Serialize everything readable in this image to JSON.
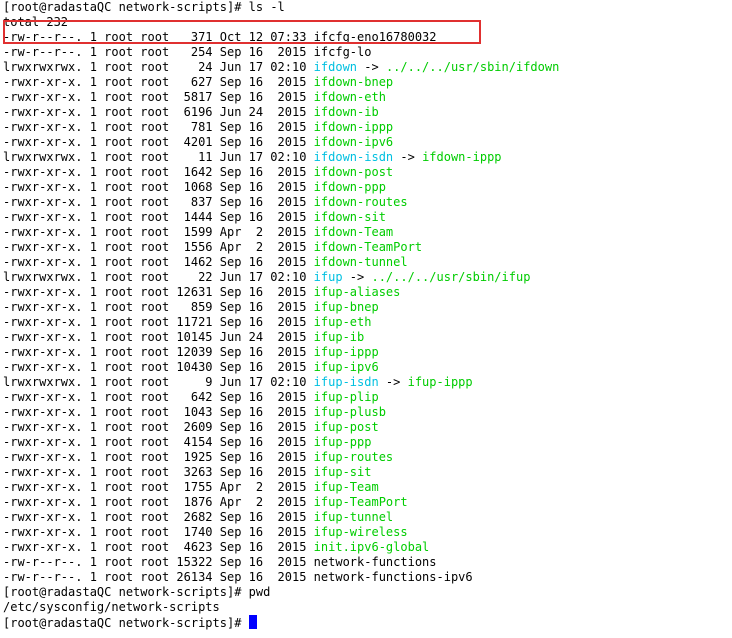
{
  "terminal": {
    "prompt": "[root@radastaQC network-scripts]# ",
    "command_ls": "ls -l",
    "total": "total 232",
    "entries": [
      {
        "meta": "-rw-r--r--. 1 root root   371 Oct 12 07:33 ",
        "name": "ifcfg-eno16780032",
        "kind": "regular"
      },
      {
        "meta": "-rw-r--r--. 1 root root   254 Sep 16  2015 ",
        "name": "ifcfg-lo",
        "kind": "regular"
      },
      {
        "meta": "lrwxrwxrwx. 1 root root    24 Jun 17 02:10 ",
        "name": "ifdown",
        "kind": "link",
        "target": "../../../usr/sbin/ifdown",
        "target_kind": "exec"
      },
      {
        "meta": "-rwxr-xr-x. 1 root root   627 Sep 16  2015 ",
        "name": "ifdown-bnep",
        "kind": "exec"
      },
      {
        "meta": "-rwxr-xr-x. 1 root root  5817 Sep 16  2015 ",
        "name": "ifdown-eth",
        "kind": "exec"
      },
      {
        "meta": "-rwxr-xr-x. 1 root root  6196 Jun 24  2015 ",
        "name": "ifdown-ib",
        "kind": "exec"
      },
      {
        "meta": "-rwxr-xr-x. 1 root root   781 Sep 16  2015 ",
        "name": "ifdown-ippp",
        "kind": "exec"
      },
      {
        "meta": "-rwxr-xr-x. 1 root root  4201 Sep 16  2015 ",
        "name": "ifdown-ipv6",
        "kind": "exec"
      },
      {
        "meta": "lrwxrwxrwx. 1 root root    11 Jun 17 02:10 ",
        "name": "ifdown-isdn",
        "kind": "link",
        "target": "ifdown-ippp",
        "target_kind": "exec"
      },
      {
        "meta": "-rwxr-xr-x. 1 root root  1642 Sep 16  2015 ",
        "name": "ifdown-post",
        "kind": "exec"
      },
      {
        "meta": "-rwxr-xr-x. 1 root root  1068 Sep 16  2015 ",
        "name": "ifdown-ppp",
        "kind": "exec"
      },
      {
        "meta": "-rwxr-xr-x. 1 root root   837 Sep 16  2015 ",
        "name": "ifdown-routes",
        "kind": "exec"
      },
      {
        "meta": "-rwxr-xr-x. 1 root root  1444 Sep 16  2015 ",
        "name": "ifdown-sit",
        "kind": "exec"
      },
      {
        "meta": "-rwxr-xr-x. 1 root root  1599 Apr  2  2015 ",
        "name": "ifdown-Team",
        "kind": "exec"
      },
      {
        "meta": "-rwxr-xr-x. 1 root root  1556 Apr  2  2015 ",
        "name": "ifdown-TeamPort",
        "kind": "exec"
      },
      {
        "meta": "-rwxr-xr-x. 1 root root  1462 Sep 16  2015 ",
        "name": "ifdown-tunnel",
        "kind": "exec"
      },
      {
        "meta": "lrwxrwxrwx. 1 root root    22 Jun 17 02:10 ",
        "name": "ifup",
        "kind": "link",
        "target": "../../../usr/sbin/ifup",
        "target_kind": "exec"
      },
      {
        "meta": "-rwxr-xr-x. 1 root root 12631 Sep 16  2015 ",
        "name": "ifup-aliases",
        "kind": "exec"
      },
      {
        "meta": "-rwxr-xr-x. 1 root root   859 Sep 16  2015 ",
        "name": "ifup-bnep",
        "kind": "exec"
      },
      {
        "meta": "-rwxr-xr-x. 1 root root 11721 Sep 16  2015 ",
        "name": "ifup-eth",
        "kind": "exec"
      },
      {
        "meta": "-rwxr-xr-x. 1 root root 10145 Jun 24  2015 ",
        "name": "ifup-ib",
        "kind": "exec"
      },
      {
        "meta": "-rwxr-xr-x. 1 root root 12039 Sep 16  2015 ",
        "name": "ifup-ippp",
        "kind": "exec"
      },
      {
        "meta": "-rwxr-xr-x. 1 root root 10430 Sep 16  2015 ",
        "name": "ifup-ipv6",
        "kind": "exec"
      },
      {
        "meta": "lrwxrwxrwx. 1 root root     9 Jun 17 02:10 ",
        "name": "ifup-isdn",
        "kind": "link",
        "target": "ifup-ippp",
        "target_kind": "exec"
      },
      {
        "meta": "-rwxr-xr-x. 1 root root   642 Sep 16  2015 ",
        "name": "ifup-plip",
        "kind": "exec"
      },
      {
        "meta": "-rwxr-xr-x. 1 root root  1043 Sep 16  2015 ",
        "name": "ifup-plusb",
        "kind": "exec"
      },
      {
        "meta": "-rwxr-xr-x. 1 root root  2609 Sep 16  2015 ",
        "name": "ifup-post",
        "kind": "exec"
      },
      {
        "meta": "-rwxr-xr-x. 1 root root  4154 Sep 16  2015 ",
        "name": "ifup-ppp",
        "kind": "exec"
      },
      {
        "meta": "-rwxr-xr-x. 1 root root  1925 Sep 16  2015 ",
        "name": "ifup-routes",
        "kind": "exec"
      },
      {
        "meta": "-rwxr-xr-x. 1 root root  3263 Sep 16  2015 ",
        "name": "ifup-sit",
        "kind": "exec"
      },
      {
        "meta": "-rwxr-xr-x. 1 root root  1755 Apr  2  2015 ",
        "name": "ifup-Team",
        "kind": "exec"
      },
      {
        "meta": "-rwxr-xr-x. 1 root root  1876 Apr  2  2015 ",
        "name": "ifup-TeamPort",
        "kind": "exec"
      },
      {
        "meta": "-rwxr-xr-x. 1 root root  2682 Sep 16  2015 ",
        "name": "ifup-tunnel",
        "kind": "exec"
      },
      {
        "meta": "-rwxr-xr-x. 1 root root  1740 Sep 16  2015 ",
        "name": "ifup-wireless",
        "kind": "exec"
      },
      {
        "meta": "-rwxr-xr-x. 1 root root  4623 Sep 16  2015 ",
        "name": "init.ipv6-global",
        "kind": "exec"
      },
      {
        "meta": "-rw-r--r--. 1 root root 15322 Sep 16  2015 ",
        "name": "network-functions",
        "kind": "regular"
      },
      {
        "meta": "-rw-r--r--. 1 root root 26134 Sep 16  2015 ",
        "name": "network-functions-ipv6",
        "kind": "regular"
      }
    ],
    "command_pwd": "pwd",
    "pwd_output": "/etc/sysconfig/network-scripts",
    "link_arrow": " -> ",
    "colors": {
      "regular": "#000000",
      "exec": "#00cc00",
      "link": "#00c0e0",
      "highlight": "#e03030",
      "cursor": "#0000ff"
    }
  }
}
